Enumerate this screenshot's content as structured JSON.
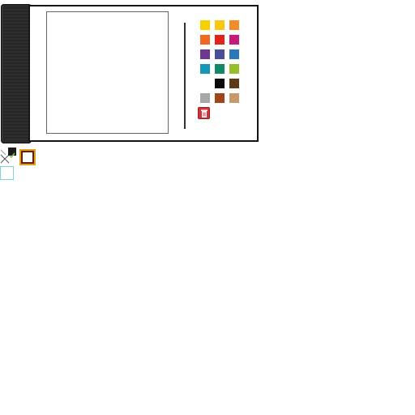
{
  "palette": {
    "colors": [
      {
        "name": "yellow",
        "hex": "#f7d000"
      },
      {
        "name": "gold",
        "hex": "#f9c80e"
      },
      {
        "name": "orange",
        "hex": "#f28c28"
      },
      {
        "name": "dark-orange",
        "hex": "#ee6a24"
      },
      {
        "name": "red",
        "hex": "#e2231a"
      },
      {
        "name": "magenta",
        "hex": "#c8197c"
      },
      {
        "name": "purple",
        "hex": "#6b3a8e"
      },
      {
        "name": "indigo",
        "hex": "#4a4e9a"
      },
      {
        "name": "blue",
        "hex": "#2a78b8"
      },
      {
        "name": "cyan",
        "hex": "#1397b8"
      },
      {
        "name": "teal",
        "hex": "#10896a"
      },
      {
        "name": "lime",
        "hex": "#96bf2c"
      },
      {
        "name": "white",
        "hex": "#ffffff"
      },
      {
        "name": "black",
        "hex": "#0a0a0a"
      },
      {
        "name": "dark-brown",
        "hex": "#5e3a17"
      },
      {
        "name": "gray",
        "hex": "#a7a7a7"
      },
      {
        "name": "rust",
        "hex": "#a2441a"
      },
      {
        "name": "tan",
        "hex": "#c79a6c"
      }
    ],
    "delete_icon": "trash-icon"
  },
  "tools": {
    "eraser_icon": "cross-icon",
    "check_icon": "checkbox-checked-icon",
    "current_fill": "#ffffff",
    "current_stroke": "#6a1d0e",
    "current_border": "#e0a020",
    "empty_slot_border": "#7fd0e8"
  }
}
